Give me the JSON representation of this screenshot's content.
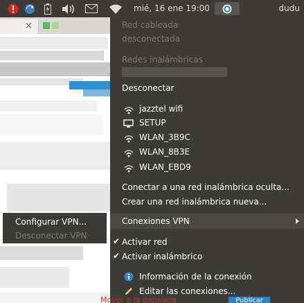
{
  "panel": {
    "clock": "mié, 16 ene  19:00",
    "user": "dudu",
    "icons": [
      "alert-icon",
      "update-icon",
      "battery-icon",
      "volume-icon",
      "mail-icon",
      "wifi-signal-icon",
      "chromium-icon"
    ]
  },
  "background_app": {
    "tab_close": "×",
    "bottom_text": "Mover a la papelera",
    "bottom_button": "Publicar"
  },
  "network_menu": {
    "wired_header": "Red cableada",
    "wired_status": "desconectada",
    "wireless_header": "Redes inalámbricas",
    "disconnect": "Desconectar",
    "networks": [
      {
        "name": "jazztel wifi",
        "icon": "wifi-icon"
      },
      {
        "name": "SETUP",
        "icon": "adhoc-network-icon"
      },
      {
        "name": "WLAN_3B9C",
        "icon": "wifi-icon"
      },
      {
        "name": "WLAN_8B3E",
        "icon": "wifi-icon"
      },
      {
        "name": "WLAN_EBD9",
        "icon": "wifi-icon"
      }
    ],
    "connect_hidden": "Conectar a una red inalámbrica oculta...",
    "create_new": "Crear una red inalámbrica nueva...",
    "vpn": "Conexiones VPN",
    "enable_network": "Activar red",
    "enable_wireless": "Activar inalámbrico",
    "connection_info": "Información de la conexión",
    "edit_connections": "Editar las conexiones..."
  },
  "vpn_submenu": {
    "configure": "Configurar VPN...",
    "disconnect": "Desconectar VPN"
  },
  "colors": {
    "panel_bg": "#3c3b37",
    "menu_bg": "#3c3b37",
    "disabled_text": "#7d7a72",
    "highlight": "#4a4844"
  }
}
